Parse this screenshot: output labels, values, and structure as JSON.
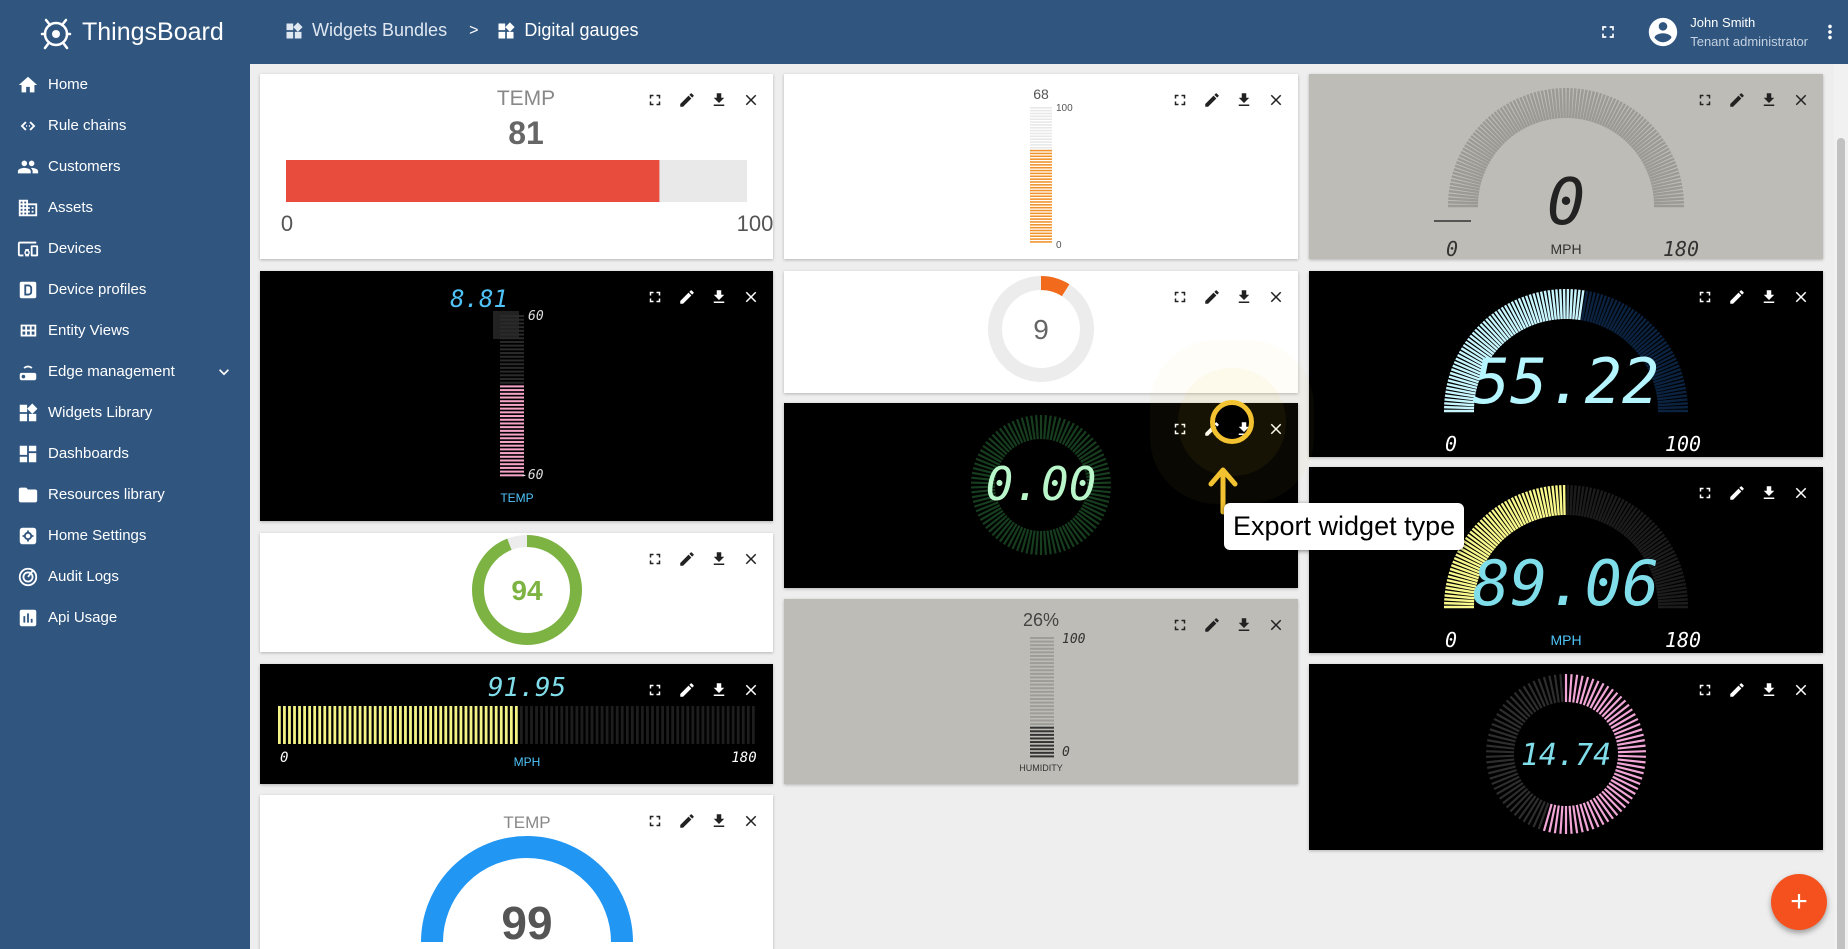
{
  "app": {
    "name": "ThingsBoard"
  },
  "breadcrumb": {
    "root": "Widgets Bundles",
    "separator": ">",
    "current": "Digital gauges"
  },
  "user": {
    "name": "John Smith",
    "role": "Tenant administrator"
  },
  "sidebar": {
    "items": [
      {
        "label": "Home",
        "icon": "home-icon"
      },
      {
        "label": "Rule chains",
        "icon": "rule-chains-icon"
      },
      {
        "label": "Customers",
        "icon": "customers-icon"
      },
      {
        "label": "Assets",
        "icon": "assets-icon"
      },
      {
        "label": "Devices",
        "icon": "devices-icon"
      },
      {
        "label": "Device profiles",
        "icon": "device-profiles-icon"
      },
      {
        "label": "Entity Views",
        "icon": "entity-views-icon"
      },
      {
        "label": "Edge management",
        "icon": "edge-icon",
        "expandable": true
      },
      {
        "label": "Widgets Library",
        "icon": "widgets-icon"
      },
      {
        "label": "Dashboards",
        "icon": "dashboards-icon"
      },
      {
        "label": "Resources library",
        "icon": "folder-icon"
      },
      {
        "label": "Home Settings",
        "icon": "settings-icon"
      },
      {
        "label": "Audit Logs",
        "icon": "audit-icon"
      },
      {
        "label": "Api Usage",
        "icon": "api-usage-icon"
      }
    ]
  },
  "widgets": {
    "horizontal_bar": {
      "label": "TEMP",
      "value": "81",
      "min": "0",
      "max": "100",
      "fraction": 0.81,
      "fill_color": "#e74c3c"
    },
    "vertical_bar_orange": {
      "value": "68",
      "max": "100",
      "min": "0",
      "fraction": 0.68
    },
    "digital_speedo_gray": {
      "value": "0",
      "unit": "MPH",
      "min": "0",
      "max": "180"
    },
    "thermometer_dark": {
      "value": "8.81",
      "max": "60",
      "min": "-60",
      "label": "TEMP",
      "fraction": 0.57
    },
    "donut_orange": {
      "value": "9",
      "fraction": 0.09
    },
    "speedo_cyan": {
      "value": "55.22",
      "min": "0",
      "max": "100",
      "fraction": 0.5522
    },
    "round_green_dark": {
      "value": "0.00"
    },
    "speedo_yellow": {
      "value": "89.06",
      "unit": "MPH",
      "min": "0",
      "max": "180",
      "fraction": 0.495
    },
    "donut_green": {
      "value": "94",
      "fraction": 0.94
    },
    "humidity_bar": {
      "value": "26%",
      "max": "100",
      "min": "0",
      "label": "HUMIDITY",
      "fraction": 0.26
    },
    "round_pink": {
      "value": "14.74",
      "fraction": 0.55
    },
    "hbar_yellow": {
      "value": "91.95",
      "unit": "MPH",
      "min": "0",
      "max": "180",
      "fraction": 0.51
    },
    "gauge_blue": {
      "label": "TEMP",
      "value": "99"
    }
  },
  "tooltip": {
    "text": "Export widget type"
  },
  "fab": {
    "label": "+"
  }
}
